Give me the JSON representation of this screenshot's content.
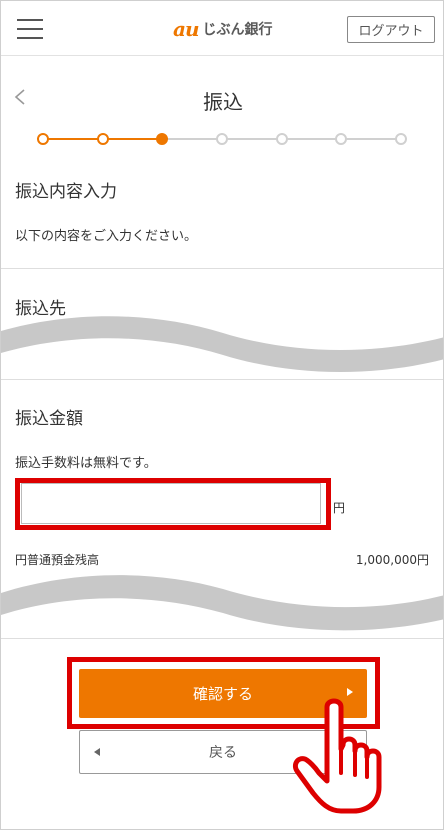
{
  "header": {
    "brand_mark": "au",
    "brand_name": "じぶん銀行",
    "logout_label": "ログアウト"
  },
  "page": {
    "title": "振込"
  },
  "stepper": {
    "total_steps": 7,
    "current_step": 3,
    "accent_color": "#ee7700",
    "inactive_color": "#d0d0d0"
  },
  "section_input": {
    "heading": "振込内容入力",
    "description": "以下の内容をご入力ください。"
  },
  "section_recipient": {
    "heading": "振込先"
  },
  "section_amount": {
    "heading": "振込金額",
    "fee_note": "振込手数料は無料です。",
    "amount_value": "",
    "unit": "円",
    "balance_label": "円普通預金残高",
    "balance_value": "1,000,000円"
  },
  "actions": {
    "confirm_label": "確認する",
    "back_label": "戻る"
  },
  "colors": {
    "brand_orange": "#ee7700",
    "highlight_red": "#dd0000",
    "wave_gray": "#c8c8c8"
  }
}
